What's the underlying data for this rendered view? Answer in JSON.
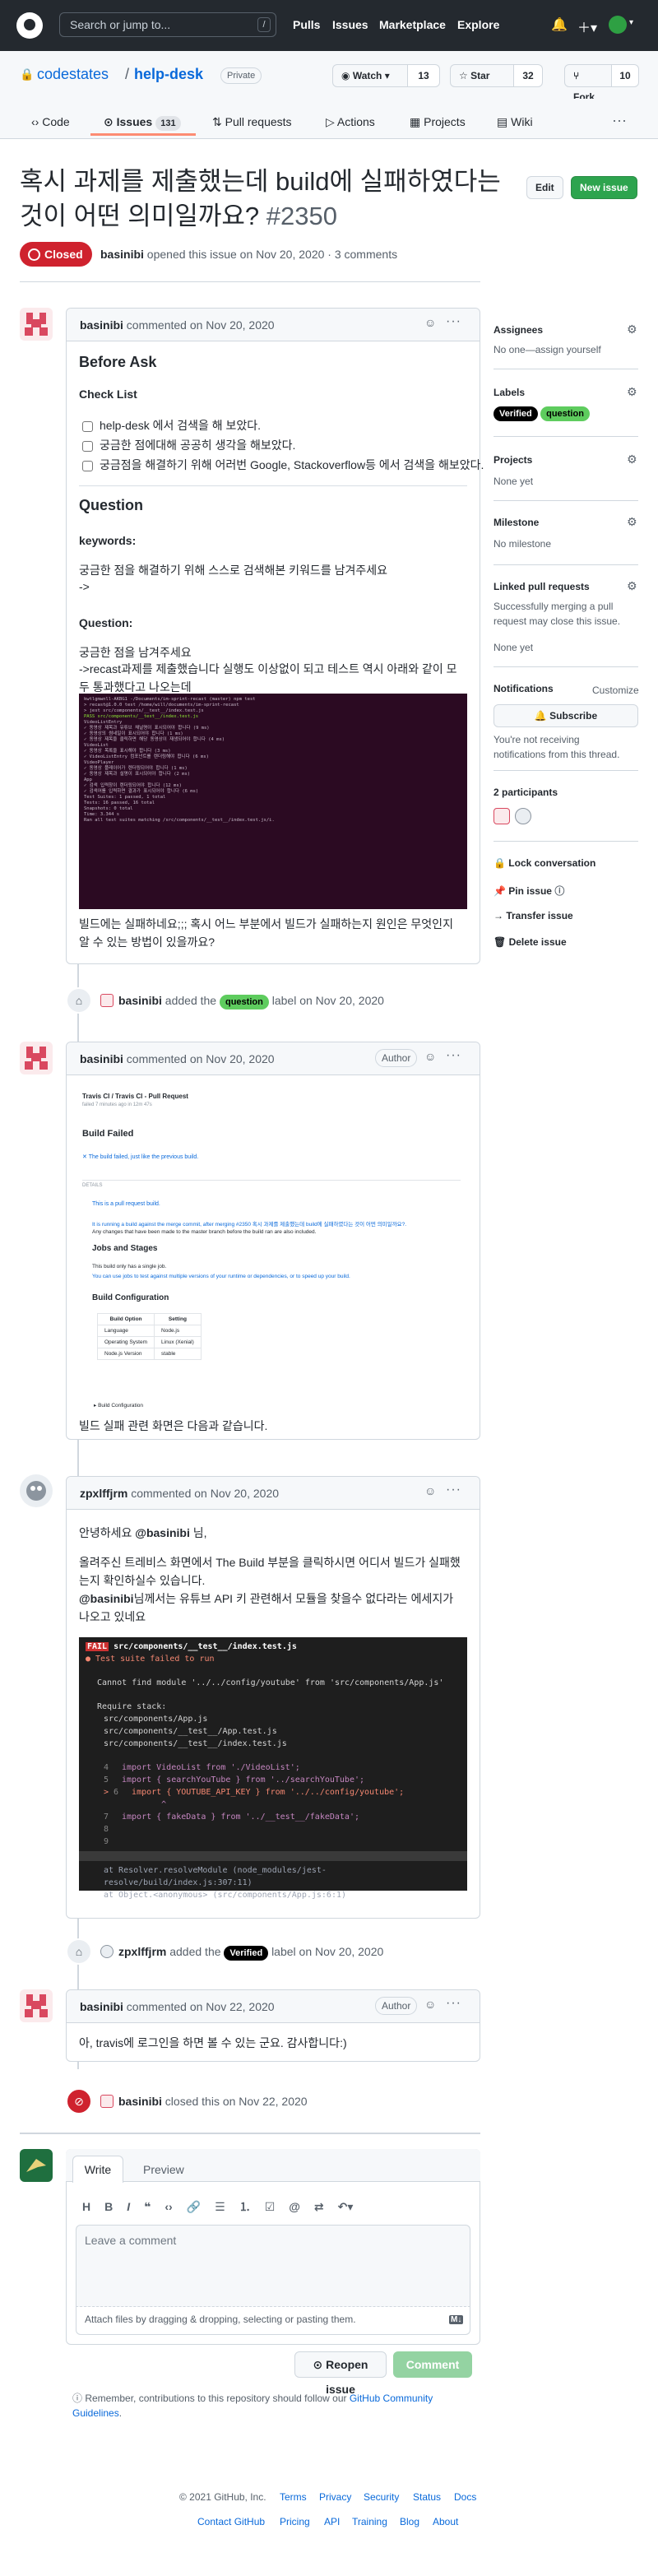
{
  "header": {
    "search_placeholder": "Search or jump to...",
    "slash": "/",
    "nav": [
      "Pulls",
      "Issues",
      "Marketplace",
      "Explore"
    ]
  },
  "repo": {
    "owner": "codestates",
    "separator": "/",
    "name": "help-desk",
    "visibility": "Private",
    "watch_label": "Watch",
    "watch_count": "13",
    "star_label": "Star",
    "star_count": "32",
    "fork_label": "Fork",
    "fork_count": "10"
  },
  "tabs": {
    "code": "Code",
    "issues": "Issues",
    "issues_count": "131",
    "pulls": "Pull requests",
    "actions": "Actions",
    "projects": "Projects",
    "wiki": "Wiki"
  },
  "issue": {
    "title": "혹시 과제를 제출했는데 build에 실패하였다는 것이 어떤 의미일까요?",
    "number": "#2350",
    "edit": "Edit",
    "new_issue": "New issue",
    "state": "Closed",
    "meta_user": "basinibi",
    "meta_text": "opened this issue on Nov 20, 2020 · 3 comments"
  },
  "c1": {
    "user": "basinibi",
    "meta": "commented on Nov 20, 2020",
    "before_ask": "Before Ask",
    "check_list": "Check List",
    "checks": [
      "help-desk 에서 검색을 해 보았다.",
      "궁금한 점에대해 공공히 생각을 해보았다.",
      "궁금점을 해결하기 위해 어러번 Google, Stackoverflow등 에서 검색을 해보았다."
    ],
    "question_h": "Question",
    "keywords": "keywords:",
    "kw_desc": "궁금한 점을 해결하기 위해 스스로 검색해본 키워드를 남겨주세요",
    "arrow": "->",
    "question": "Question:",
    "q_desc": "궁금한 점을 남겨주세요",
    "q_detail": "->recast과제를 제출했습니다 실행도 이상없이 되고 테스트 역시 아래와 같이 모두 통과했다고 나오는데",
    "q_after": "빌드에는 실패하네요;;; 혹시 어느 부분에서 빌드가 실패하는지 원인은 무엇인지 알 수 있는 방법이 있을까요?"
  },
  "terminal": [
    "kwtlgmwnll-AKBG1 -/Documents/im-sprint-recast (master) npm test",
    "> recast@1.0.0 test /home/will/documents/im-sprint-recast",
    "> jest src/components/__test__/index.test.js",
    "PASS  src/components/__test__/index.test.js",
    "  VideoListEntry",
    "    ✓ 동영상 제목과 유튜브 채널명이 표시되어야 합니다 (9 ms)",
    "    ✓ 동영상의 썸네일이 표시되어야 합니다 (1 ms)",
    "    ✓ 동영상 제목을 클릭하면 해당 동영상이 재생되어야 합니다 (4 ms)",
    "  VideoList",
    "    ✓ 동영상 목록을 표시해야 합니다 (3 ms)",
    "    ✓ VideoListEntry 컴포넌트를 렌더링해야 합니다 (6 ms)",
    "  VideoPlayer",
    "    ✓ 동영상 플레이어가 렌더링되어야 합니다 (1 ms)",
    "    ✓ 동영상 제목과 설명이 표시되어야 합니다 (2 ms)",
    "  App",
    "    ✓ 검색 입력창이 렌더링되어야 합니다 (12 ms)",
    "    ✓ 검색어를 입력하면 결과가 표시되어야 합니다 (6 ms)",
    "Test Suites: 1 passed, 1 total",
    "Tests:       16 passed, 16 total",
    "Snapshots:   0 total",
    "Time:        3.344 s",
    "Ran all test suites matching /src/components/__test__/index.test.js/i."
  ],
  "label_event": {
    "user": "basinibi",
    "before": "added the",
    "label": "question",
    "after": "label on Nov 20, 2020"
  },
  "c2": {
    "user": "basinibi",
    "meta": "commented on Nov 20, 2020",
    "author": "Author",
    "travis_title": "Travis CI / Travis CI - Pull Request",
    "travis_sub": "failed 7 minutes ago in 12m 47s",
    "build_failed": "Build Failed",
    "build_text": "The build failed, just like the previous build.",
    "details": "DETAILS",
    "pr_line": "This is a pull request build.",
    "merge_line": "It is running a build against the merge commit, after merging #2350 혹시 과제를 제출했는데 build에 실패하였다는 것이 어떤 의미일까요?.",
    "changes_line": "Any changes that have been made to the master branch before the build ran are also included.",
    "jobs": "Jobs and Stages",
    "single_job": "This build only has a single job.",
    "matrix_line": "You can use jobs to test against multiple versions of your runtime or dependencies, or to speed up your build.",
    "config": "Build Configuration",
    "cfg_head": [
      "Build Option",
      "Setting"
    ],
    "cfg_rows": [
      [
        "Language",
        "Node.js"
      ],
      [
        "Operating System",
        "Linux (Xenial)"
      ],
      [
        "Node.js Version",
        "stable"
      ]
    ],
    "cfg_more": "▸ Build Configuration",
    "after": "빌드 실패 관련 화면은 다음과 같습니다."
  },
  "c3": {
    "user": "zpxlffjrm",
    "meta": "commented on Nov 20, 2020",
    "greeting": "안녕하세요",
    "mention": "@basinibi",
    "greeting_end": "님,",
    "p1": "올려주신 트레비스 화면에서 The Build 부분을 클릭하시면 어디서 빌드가 실패했는지 확인하실수 있습니다.",
    "p2_rest": "님께서는 유튜브 API 키 관련해서 모듈을 찾을수 없다라는 에세지가 나오고 있네요"
  },
  "code": {
    "fail": "FAIL",
    "fail_path": "src/components/__test__/index.test.js",
    "suite": "● Test suite failed to run",
    "module": "Cannot find module '../../config/youtube' from 'src/components/App.js'",
    "req": "Require stack:",
    "stack": [
      "src/components/App.js",
      "src/components/__test__/App.test.js",
      "src/components/__test__/index.test.js"
    ],
    "src": [
      {
        "n": "4",
        "t": "import VideoList from './VideoList';"
      },
      {
        "n": "5",
        "t": "import { searchYouTube } from '../searchYouTube';"
      },
      {
        "n": "6",
        "t": "import { YOUTUBE_API_KEY } from '../../config/youtube';",
        "err": true
      },
      {
        "n": "",
        "t": "        ^"
      },
      {
        "n": "7",
        "t": "import { fakeData } from '../__test__/fakeData';"
      },
      {
        "n": "8",
        "t": ""
      },
      {
        "n": "9",
        "t": ""
      }
    ],
    "at": [
      "at Resolver.resolveModule (node_modules/jest-resolve/build/index.js:307:11)",
      "at Object.<anonymous> (src/components/App.js:6:1)"
    ]
  },
  "label_event2": {
    "user": "zpxlffjrm",
    "before": "added the",
    "label": "Verified",
    "after": "label on Nov 20, 2020"
  },
  "c4": {
    "user": "basinibi",
    "meta": "commented on Nov 22, 2020",
    "author": "Author",
    "text": "아, travis에 로그인을 하면 볼 수 있는 군요. 감사합니다:)"
  },
  "close_event": {
    "user": "basinibi",
    "text": "closed this on Nov 22, 2020"
  },
  "composer": {
    "write": "Write",
    "preview": "Preview",
    "placeholder": "Leave a comment",
    "attach": "Attach files by dragging & dropping, selecting or pasting them.",
    "reopen": "Reopen issue",
    "comment": "Comment",
    "md": "M↓"
  },
  "guidelines": {
    "text": "Remember, contributions to this repository should follow our",
    "link": "GitHub Community Guidelines",
    "end": "."
  },
  "sidebar": {
    "assignees": "Assignees",
    "assignees_val": "No one—assign yourself",
    "labels": "Labels",
    "projects": "Projects",
    "projects_val": "None yet",
    "milestone": "Milestone",
    "milestone_val": "No milestone",
    "linked": "Linked pull requests",
    "linked_val": "Successfully merging a pull request may close this issue.",
    "linked_none": "None yet",
    "notifications": "Notifications",
    "customize": "Customize",
    "subscribe": "Subscribe",
    "notif_text": "You're not receiving notifications from this thread.",
    "participants": "2 participants",
    "lock": "Lock conversation",
    "pin": "Pin issue",
    "transfer": "Transfer issue",
    "delete": "Delete issue"
  },
  "labels": [
    {
      "name": "Verified",
      "color": "#000000",
      "text": "#ffffff"
    },
    {
      "name": "question",
      "color": "#5ecc5e",
      "text": "#000000"
    }
  ],
  "footer": {
    "copyright": "© 2021 GitHub, Inc.",
    "row1": [
      "Terms",
      "Privacy",
      "Security",
      "Status",
      "Docs"
    ],
    "row2": [
      "Contact GitHub",
      "Pricing",
      "API",
      "Training",
      "Blog",
      "About"
    ]
  }
}
